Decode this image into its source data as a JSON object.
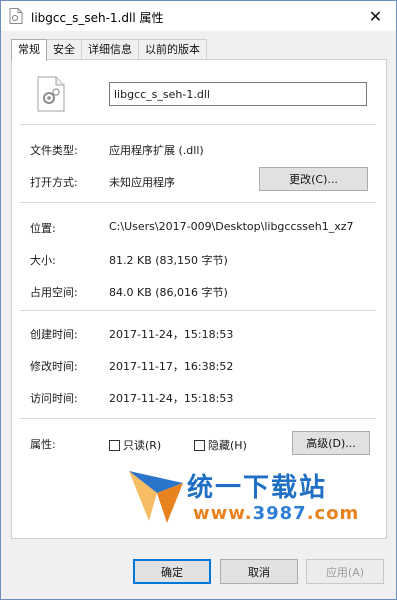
{
  "window": {
    "title": "libgcc_s_seh-1.dll 属性",
    "close_glyph": "✕"
  },
  "tabs": [
    {
      "label": "常规",
      "active": true
    },
    {
      "label": "安全",
      "active": false
    },
    {
      "label": "详细信息",
      "active": false
    },
    {
      "label": "以前的版本",
      "active": false
    }
  ],
  "general": {
    "file_name": "libgcc_s_seh-1.dll",
    "file_type_label": "文件类型:",
    "file_type_value": "应用程序扩展 (.dll)",
    "open_with_label": "打开方式:",
    "open_with_value": "未知应用程序",
    "change_button": "更改(C)...",
    "location_label": "位置:",
    "location_value": "C:\\Users\\2017-009\\Desktop\\libgccsseh1_xz7",
    "size_label": "大小:",
    "size_value": "81.2 KB (83,150 字节)",
    "size_on_disk_label": "占用空间:",
    "size_on_disk_value": "84.0 KB (86,016 字节)",
    "created_label": "创建时间:",
    "created_value": "2017-11-24，15:18:53",
    "modified_label": "修改时间:",
    "modified_value": "2017-11-17，16:38:52",
    "accessed_label": "访问时间:",
    "accessed_value": "2017-11-24，15:18:53",
    "attributes_label": "属性:",
    "readonly_label": "只读(R)",
    "readonly_checked": false,
    "hidden_label": "隐藏(H)",
    "hidden_checked": false,
    "advanced_button": "高级(D)..."
  },
  "watermark": {
    "text_cn": "统一下载站",
    "url_prefix": "www.",
    "url_number": "3987",
    "url_suffix": ".com"
  },
  "footer": {
    "ok": "确定",
    "cancel": "取消",
    "apply": "应用(A)"
  },
  "colors": {
    "accent": "#0078d7",
    "watermark_blue": "#1f6fc4",
    "watermark_orange": "#e8821e"
  }
}
